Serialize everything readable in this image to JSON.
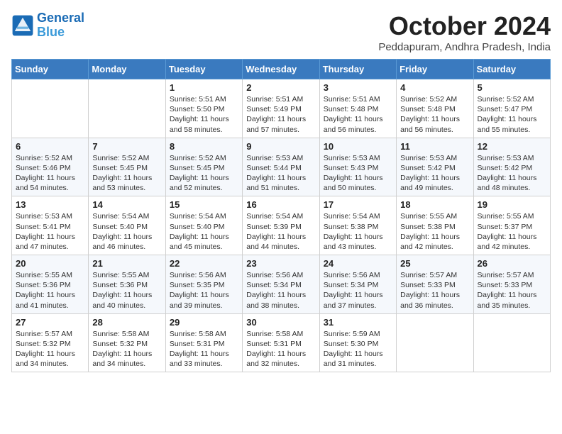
{
  "header": {
    "logo_line1": "General",
    "logo_line2": "Blue",
    "month": "October 2024",
    "location": "Peddapuram, Andhra Pradesh, India"
  },
  "weekdays": [
    "Sunday",
    "Monday",
    "Tuesday",
    "Wednesday",
    "Thursday",
    "Friday",
    "Saturday"
  ],
  "weeks": [
    [
      {
        "day": "",
        "info": ""
      },
      {
        "day": "",
        "info": ""
      },
      {
        "day": "1",
        "info": "Sunrise: 5:51 AM\nSunset: 5:50 PM\nDaylight: 11 hours and 58 minutes."
      },
      {
        "day": "2",
        "info": "Sunrise: 5:51 AM\nSunset: 5:49 PM\nDaylight: 11 hours and 57 minutes."
      },
      {
        "day": "3",
        "info": "Sunrise: 5:51 AM\nSunset: 5:48 PM\nDaylight: 11 hours and 56 minutes."
      },
      {
        "day": "4",
        "info": "Sunrise: 5:52 AM\nSunset: 5:48 PM\nDaylight: 11 hours and 56 minutes."
      },
      {
        "day": "5",
        "info": "Sunrise: 5:52 AM\nSunset: 5:47 PM\nDaylight: 11 hours and 55 minutes."
      }
    ],
    [
      {
        "day": "6",
        "info": "Sunrise: 5:52 AM\nSunset: 5:46 PM\nDaylight: 11 hours and 54 minutes."
      },
      {
        "day": "7",
        "info": "Sunrise: 5:52 AM\nSunset: 5:45 PM\nDaylight: 11 hours and 53 minutes."
      },
      {
        "day": "8",
        "info": "Sunrise: 5:52 AM\nSunset: 5:45 PM\nDaylight: 11 hours and 52 minutes."
      },
      {
        "day": "9",
        "info": "Sunrise: 5:53 AM\nSunset: 5:44 PM\nDaylight: 11 hours and 51 minutes."
      },
      {
        "day": "10",
        "info": "Sunrise: 5:53 AM\nSunset: 5:43 PM\nDaylight: 11 hours and 50 minutes."
      },
      {
        "day": "11",
        "info": "Sunrise: 5:53 AM\nSunset: 5:42 PM\nDaylight: 11 hours and 49 minutes."
      },
      {
        "day": "12",
        "info": "Sunrise: 5:53 AM\nSunset: 5:42 PM\nDaylight: 11 hours and 48 minutes."
      }
    ],
    [
      {
        "day": "13",
        "info": "Sunrise: 5:53 AM\nSunset: 5:41 PM\nDaylight: 11 hours and 47 minutes."
      },
      {
        "day": "14",
        "info": "Sunrise: 5:54 AM\nSunset: 5:40 PM\nDaylight: 11 hours and 46 minutes."
      },
      {
        "day": "15",
        "info": "Sunrise: 5:54 AM\nSunset: 5:40 PM\nDaylight: 11 hours and 45 minutes."
      },
      {
        "day": "16",
        "info": "Sunrise: 5:54 AM\nSunset: 5:39 PM\nDaylight: 11 hours and 44 minutes."
      },
      {
        "day": "17",
        "info": "Sunrise: 5:54 AM\nSunset: 5:38 PM\nDaylight: 11 hours and 43 minutes."
      },
      {
        "day": "18",
        "info": "Sunrise: 5:55 AM\nSunset: 5:38 PM\nDaylight: 11 hours and 42 minutes."
      },
      {
        "day": "19",
        "info": "Sunrise: 5:55 AM\nSunset: 5:37 PM\nDaylight: 11 hours and 42 minutes."
      }
    ],
    [
      {
        "day": "20",
        "info": "Sunrise: 5:55 AM\nSunset: 5:36 PM\nDaylight: 11 hours and 41 minutes."
      },
      {
        "day": "21",
        "info": "Sunrise: 5:55 AM\nSunset: 5:36 PM\nDaylight: 11 hours and 40 minutes."
      },
      {
        "day": "22",
        "info": "Sunrise: 5:56 AM\nSunset: 5:35 PM\nDaylight: 11 hours and 39 minutes."
      },
      {
        "day": "23",
        "info": "Sunrise: 5:56 AM\nSunset: 5:34 PM\nDaylight: 11 hours and 38 minutes."
      },
      {
        "day": "24",
        "info": "Sunrise: 5:56 AM\nSunset: 5:34 PM\nDaylight: 11 hours and 37 minutes."
      },
      {
        "day": "25",
        "info": "Sunrise: 5:57 AM\nSunset: 5:33 PM\nDaylight: 11 hours and 36 minutes."
      },
      {
        "day": "26",
        "info": "Sunrise: 5:57 AM\nSunset: 5:33 PM\nDaylight: 11 hours and 35 minutes."
      }
    ],
    [
      {
        "day": "27",
        "info": "Sunrise: 5:57 AM\nSunset: 5:32 PM\nDaylight: 11 hours and 34 minutes."
      },
      {
        "day": "28",
        "info": "Sunrise: 5:58 AM\nSunset: 5:32 PM\nDaylight: 11 hours and 34 minutes."
      },
      {
        "day": "29",
        "info": "Sunrise: 5:58 AM\nSunset: 5:31 PM\nDaylight: 11 hours and 33 minutes."
      },
      {
        "day": "30",
        "info": "Sunrise: 5:58 AM\nSunset: 5:31 PM\nDaylight: 11 hours and 32 minutes."
      },
      {
        "day": "31",
        "info": "Sunrise: 5:59 AM\nSunset: 5:30 PM\nDaylight: 11 hours and 31 minutes."
      },
      {
        "day": "",
        "info": ""
      },
      {
        "day": "",
        "info": ""
      }
    ]
  ]
}
